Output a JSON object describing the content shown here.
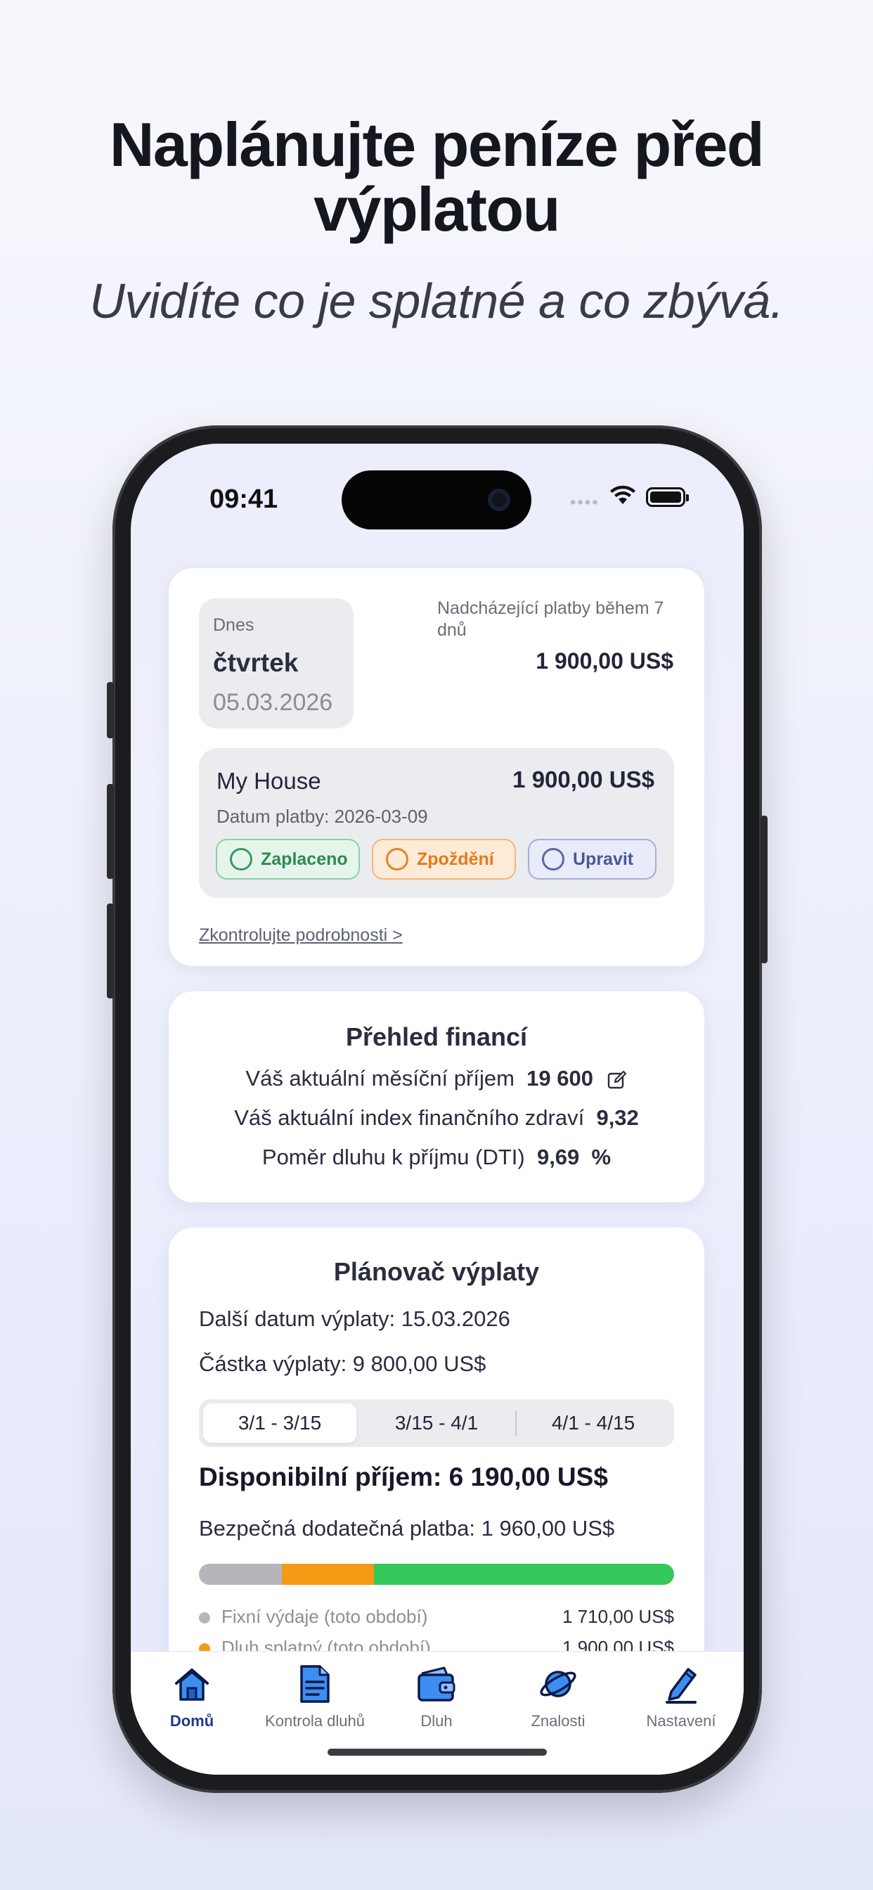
{
  "hero": {
    "title_line1": "Naplánujte peníze před",
    "title_line2": "výplatou",
    "subtitle": "Uvidíte co je splatné a co zbývá."
  },
  "status_bar": {
    "time": "09:41",
    "signal": "••••"
  },
  "today_card": {
    "today_label": "Dnes",
    "day_name": "čtvrtek",
    "date": "05.03.2026",
    "upcoming_label": "Nadcházející platby během 7 dnů",
    "upcoming_amount": "1 900,00 US$",
    "bill": {
      "name": "My House",
      "amount": "1 900,00 US$",
      "due_date": "Datum platby: 2026-03-09",
      "actions": {
        "paid": "Zaplaceno",
        "late": "Zpoždění",
        "edit": "Upravit"
      }
    },
    "details_link": "Zkontrolujte podrobnosti >"
  },
  "overview": {
    "title": "Přehled financí",
    "income_label": "Váš aktuální měsíční příjem",
    "income_value": "19 600",
    "health_label": "Váš aktuální index finančního zdraví",
    "health_value": "9,32",
    "dti_label": "Poměr dluhu k příjmu (DTI)",
    "dti_value": "9,69",
    "dti_unit": "%"
  },
  "planner": {
    "title": "Plánovač výplaty",
    "next_payday": "Další datum výplaty: 15.03.2026",
    "pay_amount": "Částka výplaty: 9 800,00 US$",
    "periods": [
      "3/1 - 3/15",
      "3/15 - 4/1",
      "4/1 - 4/15"
    ],
    "active_period": "3/1 - 3/15",
    "available": "Disponibilní příjem: 6 190,00 US$",
    "safe_extra": "Bezpečná dodatečná platba: 1 960,00 US$",
    "breakdown": [
      {
        "label": "Fixní výdaje (toto období)",
        "amount": "1 710,00 US$",
        "color": "#b5b6bb",
        "share": 0.175
      },
      {
        "label": "Dluh splatný (toto období)",
        "amount": "1 900,00 US$",
        "color": "#f59a14",
        "share": 0.194
      },
      {
        "label": "",
        "amount": "",
        "color": "#34c759",
        "share": 0.631
      }
    ]
  },
  "tabbar": {
    "items": [
      {
        "label": "Domů",
        "icon": "home-icon",
        "active": true
      },
      {
        "label": "Kontrola dluhů",
        "icon": "document-icon",
        "active": false
      },
      {
        "label": "Dluh",
        "icon": "wallet-icon",
        "active": false
      },
      {
        "label": "Znalosti",
        "icon": "planet-icon",
        "active": false
      },
      {
        "label": "Nastavení",
        "icon": "pencil-icon",
        "active": false
      }
    ]
  }
}
